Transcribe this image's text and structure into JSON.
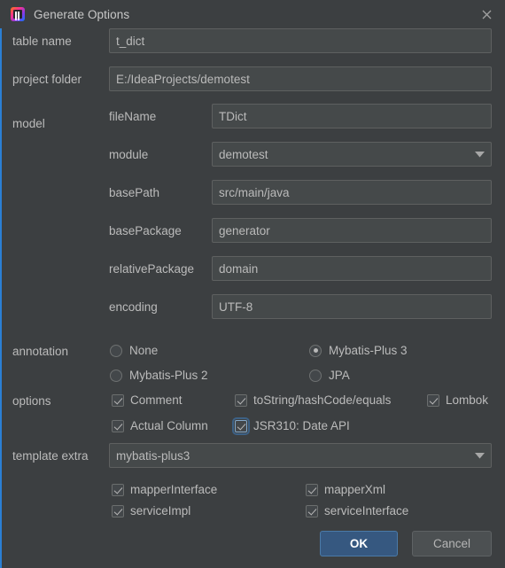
{
  "window": {
    "title": "Generate Options",
    "app_icon": "intellij-idea-icon",
    "close_icon": "close-icon",
    "accent_color": "#2a7fd4",
    "background_color": "#3c3f41"
  },
  "fields": {
    "table_name": {
      "label": "table name",
      "value": "t_dict"
    },
    "project_folder": {
      "label": "project folder",
      "value": "E:/IdeaProjects/demotest"
    }
  },
  "model": {
    "label": "model",
    "rows": [
      {
        "label": "fileName",
        "value": "TDict",
        "type": "text"
      },
      {
        "label": "module",
        "value": "demotest",
        "type": "combo"
      },
      {
        "label": "basePath",
        "value": "src/main/java",
        "type": "text"
      },
      {
        "label": "basePackage",
        "value": "generator",
        "type": "text"
      },
      {
        "label": "relativePackage",
        "value": "domain",
        "type": "text"
      },
      {
        "label": "encoding",
        "value": "UTF-8",
        "type": "text"
      }
    ]
  },
  "annotation": {
    "label": "annotation",
    "options": [
      {
        "label": "None",
        "selected": false
      },
      {
        "label": "Mybatis-Plus 3",
        "selected": true
      },
      {
        "label": "Mybatis-Plus 2",
        "selected": false
      },
      {
        "label": "JPA",
        "selected": false
      }
    ]
  },
  "options": {
    "label": "options",
    "items": [
      {
        "label": "Comment",
        "checked": true,
        "focused": false
      },
      {
        "label": "toString/hashCode/equals",
        "checked": true,
        "focused": false
      },
      {
        "label": "Lombok",
        "checked": true,
        "focused": false
      },
      {
        "label": "Actual Column",
        "checked": true,
        "focused": false
      },
      {
        "label": "JSR310: Date API",
        "checked": true,
        "focused": true
      }
    ]
  },
  "template_extra": {
    "label": "template extra",
    "value": "mybatis-plus3",
    "items": [
      {
        "label": "mapperInterface",
        "checked": true
      },
      {
        "label": "mapperXml",
        "checked": true
      },
      {
        "label": "serviceImpl",
        "checked": true
      },
      {
        "label": "serviceInterface",
        "checked": true
      }
    ]
  },
  "buttons": {
    "ok": "OK",
    "cancel": "Cancel"
  }
}
